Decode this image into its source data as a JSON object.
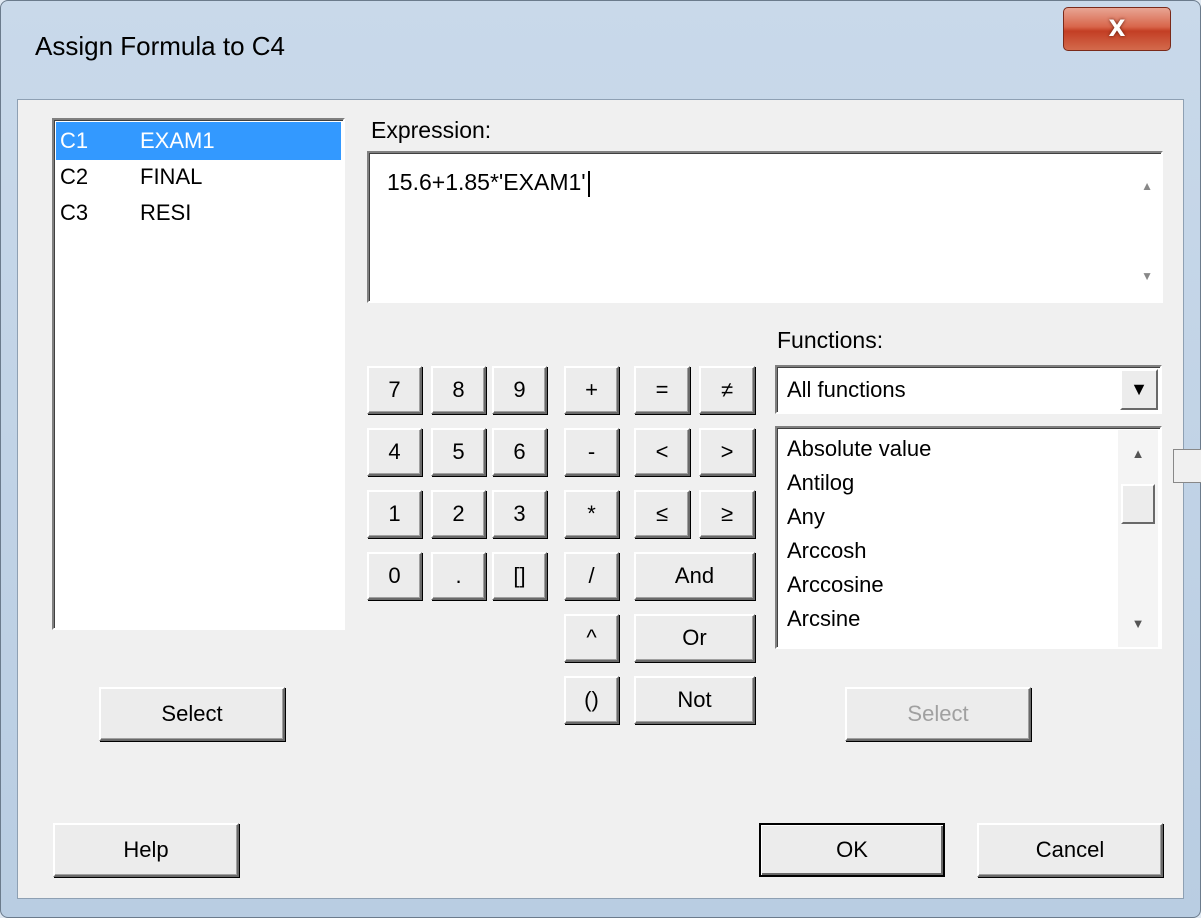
{
  "window": {
    "title": "Assign Formula to C4",
    "close_label": "X"
  },
  "columns": [
    {
      "id": "C1",
      "name": "EXAM1",
      "selected": true
    },
    {
      "id": "C2",
      "name": "FINAL",
      "selected": false
    },
    {
      "id": "C3",
      "name": "RESI",
      "selected": false
    }
  ],
  "expression": {
    "label": "Expression:",
    "value": "15.6+1.85*'EXAM1'"
  },
  "keypad": {
    "digits": [
      "7",
      "8",
      "9",
      "4",
      "5",
      "6",
      "1",
      "2",
      "3",
      "0",
      ".",
      "[]"
    ],
    "ops_col1": [
      "+",
      "-",
      "*",
      "/",
      "^",
      "()"
    ],
    "ops_col2": [
      "=",
      "<",
      "≤"
    ],
    "ops_col3": [
      "≠",
      ">",
      "≥"
    ],
    "logic": [
      "And",
      "Or",
      "Not"
    ]
  },
  "functions": {
    "label": "Functions:",
    "filter_selected": "All functions",
    "items": [
      "Absolute value",
      "Antilog",
      "Any",
      "Arccosh",
      "Arccosine",
      "Arcsine"
    ],
    "select_label": "Select",
    "select_enabled": false
  },
  "buttons": {
    "select": "Select",
    "help": "Help",
    "ok": "OK",
    "cancel": "Cancel"
  }
}
